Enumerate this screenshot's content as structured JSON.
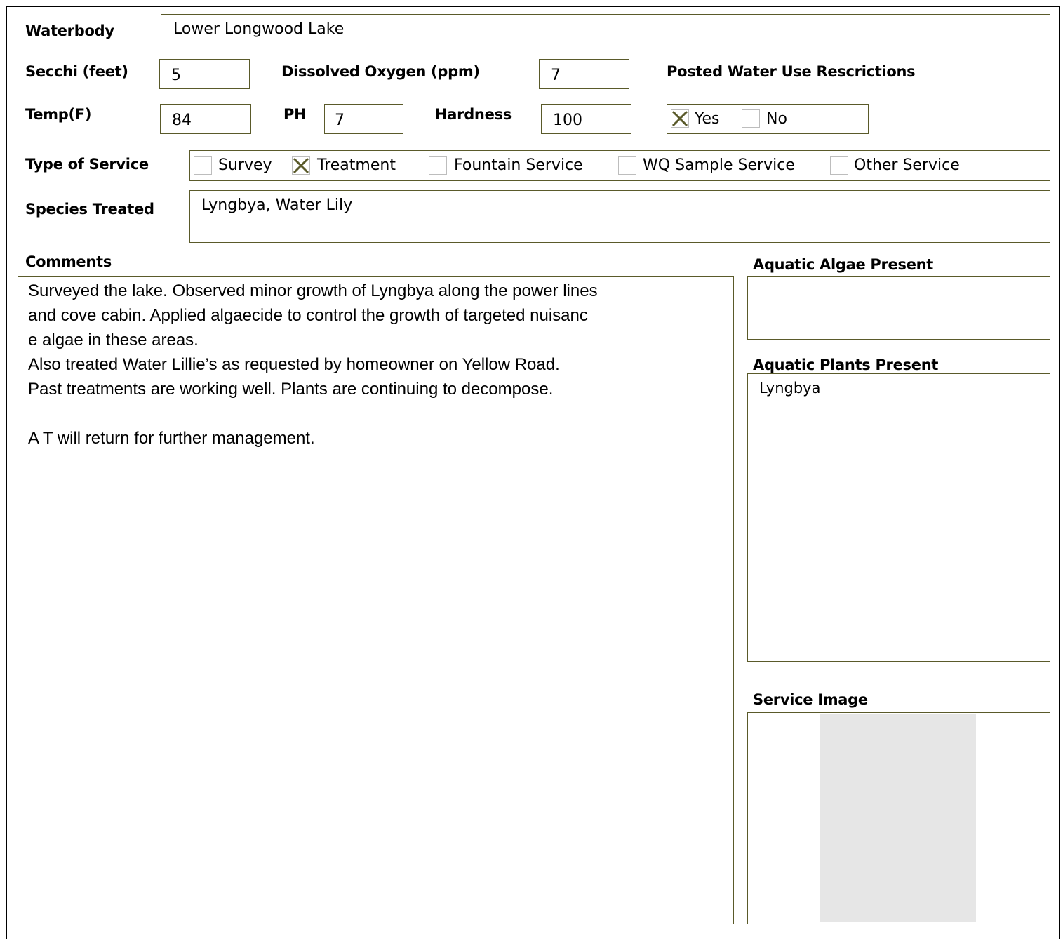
{
  "waterbody": {
    "label": "Waterbody",
    "value": "Lower Longwood Lake"
  },
  "secchi": {
    "label": "Secchi (feet)",
    "value": "5"
  },
  "dissolved_oxygen": {
    "label": "Dissolved Oxygen (ppm)",
    "value": "7"
  },
  "posted_restrictions": {
    "label": "Posted Water Use Rescrictions",
    "options": [
      {
        "label": "Yes",
        "checked": true
      },
      {
        "label": "No",
        "checked": false
      }
    ]
  },
  "temp": {
    "label": "Temp(F)",
    "value": "84"
  },
  "ph": {
    "label": "PH",
    "value": "7"
  },
  "hardness": {
    "label": "Hardness",
    "value": "100"
  },
  "service_type": {
    "label": "Type of Service",
    "options": [
      {
        "label": "Survey",
        "checked": false
      },
      {
        "label": "Treatment",
        "checked": true
      },
      {
        "label": "Fountain Service",
        "checked": false
      },
      {
        "label": "WQ Sample Service",
        "checked": false
      },
      {
        "label": "Other Service",
        "checked": false
      }
    ]
  },
  "species_treated": {
    "label": "Species Treated",
    "value": "Lyngbya, Water Lily"
  },
  "comments": {
    "label": "Comments",
    "lines": [
      "Surveyed the lake. Observed minor growth of Lyngbya along the power lines",
      " and cove cabin. Applied algaecide to control the growth of targeted nuisanc",
      "e algae in these areas.",
      "Also treated Water Lillie’s as requested by homeowner on Yellow Road.",
      "Past treatments are working well. Plants are continuing to decompose.",
      "",
      "A T will return for further management."
    ]
  },
  "algae": {
    "label": "Aquatic Algae Present",
    "value": ""
  },
  "plants": {
    "label": "Aquatic Plants Present",
    "value": "Lyngbya"
  },
  "service_image": {
    "label": "Service Image"
  },
  "colors": {
    "border": "#5a5a2a",
    "check": "#5a5a2a",
    "image_placeholder": "#e6e6e6"
  }
}
